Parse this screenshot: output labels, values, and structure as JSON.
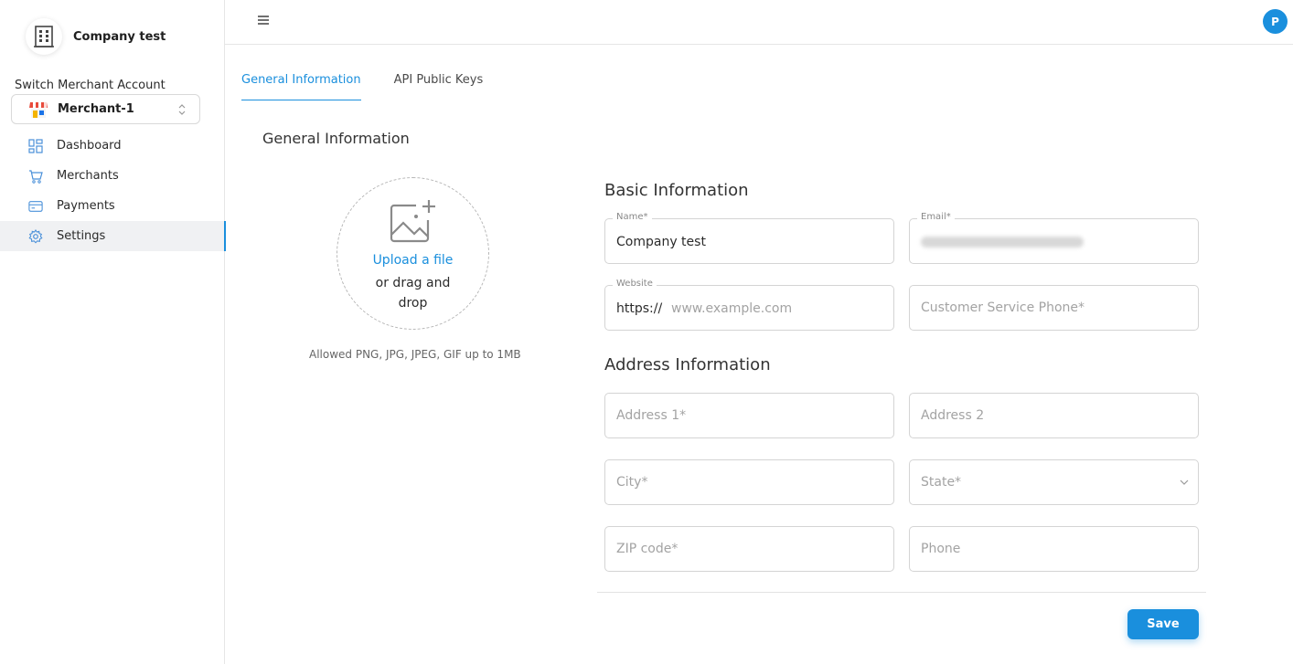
{
  "sidebar": {
    "company_name": "Company test",
    "switch_label": "Switch Merchant Account",
    "merchant_selected": "Merchant-1",
    "items": [
      {
        "label": "Dashboard",
        "icon": "dashboard-icon"
      },
      {
        "label": "Merchants",
        "icon": "cart-icon"
      },
      {
        "label": "Payments",
        "icon": "credit-card-icon"
      },
      {
        "label": "Settings",
        "icon": "gear-icon",
        "active": true
      }
    ]
  },
  "header": {
    "menu_icon": "hamburger-menu-icon",
    "avatar_initial": "P"
  },
  "tabs": [
    {
      "label": "General Information",
      "active": true
    },
    {
      "label": "API Public Keys",
      "active": false
    }
  ],
  "main": {
    "section_title": "General Information",
    "upload": {
      "link": "Upload a file",
      "sub": "or drag and drop",
      "hint": "Allowed PNG, JPG, JPEG, GIF up to 1MB"
    },
    "basic_title": "Basic Information",
    "address_title": "Address Information",
    "fields": {
      "name": {
        "label": "Name*",
        "value": "Company test"
      },
      "email": {
        "label": "Email*",
        "value": ""
      },
      "website": {
        "label": "Website",
        "prefix": "https://",
        "placeholder": "www.example.com"
      },
      "cs_phone": {
        "placeholder": "Customer Service Phone*"
      },
      "address1": {
        "placeholder": "Address 1*"
      },
      "address2": {
        "placeholder": "Address 2"
      },
      "city": {
        "placeholder": "City*"
      },
      "state": {
        "placeholder": "State*"
      },
      "zip": {
        "placeholder": "ZIP code*"
      },
      "phone": {
        "placeholder": "Phone"
      }
    },
    "save_label": "Save"
  },
  "colors": {
    "accent": "#1a8fdd",
    "active_nav_bg": "#f0f1f3",
    "border": "#d4d4d4"
  }
}
